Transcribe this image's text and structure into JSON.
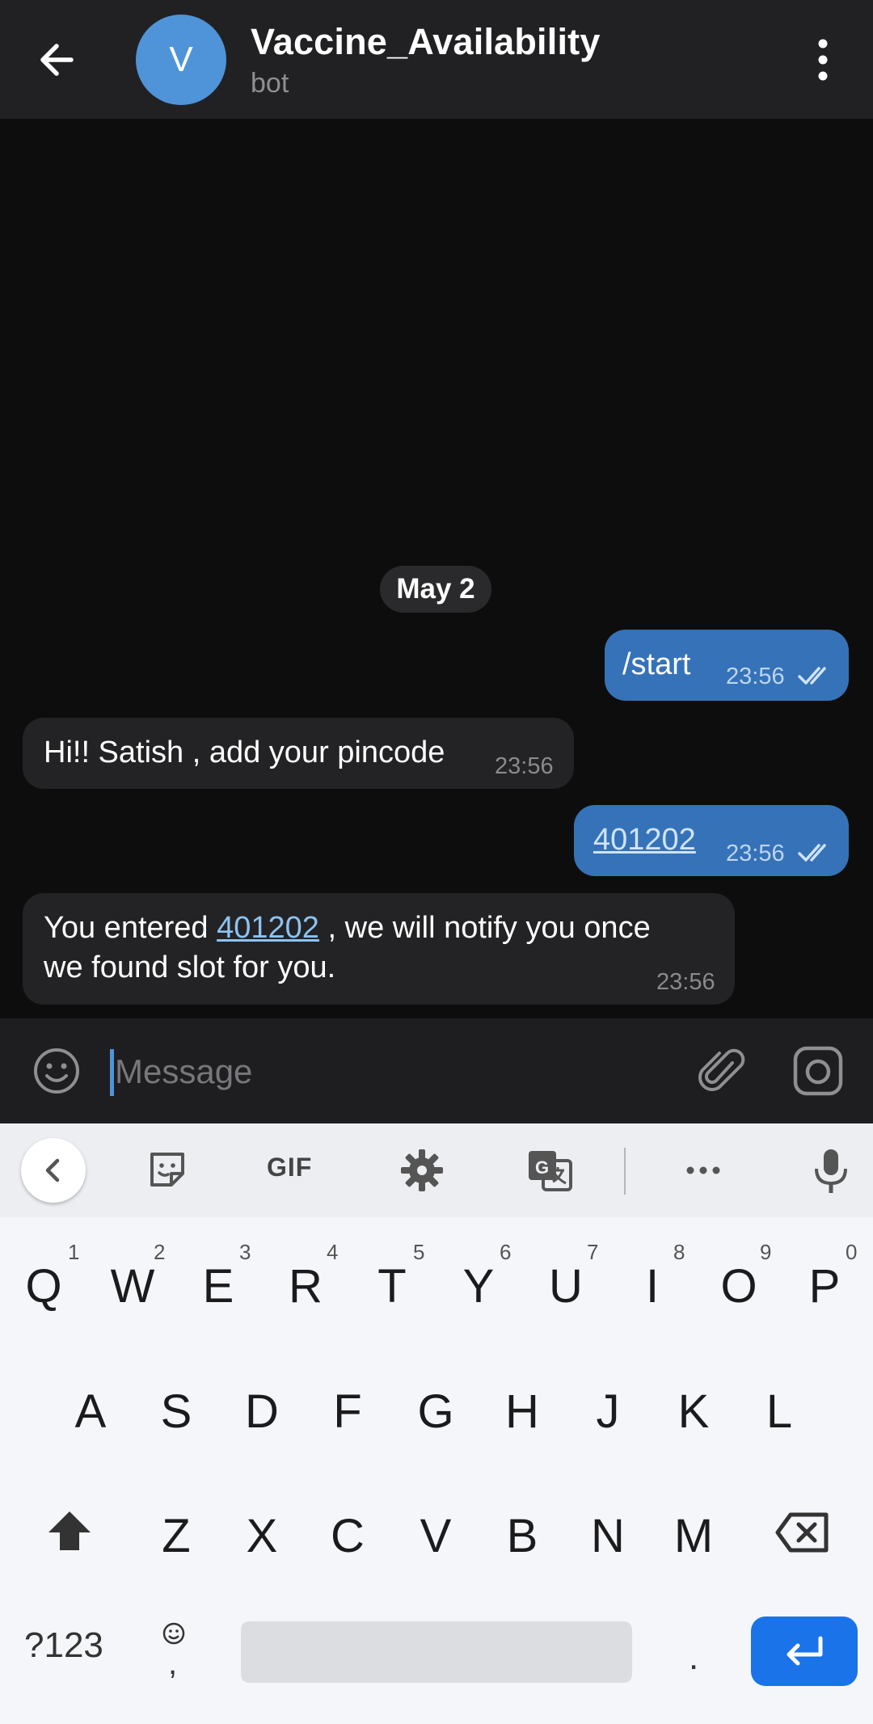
{
  "header": {
    "back_icon": "arrow-left-icon",
    "avatar_letter": "V",
    "title": "Vaccine_Availability",
    "subtitle": "bot",
    "menu_icon": "more-vertical-icon"
  },
  "chat": {
    "date_chip": "May 2",
    "messages": [
      {
        "direction": "out",
        "text": "/start",
        "time": "23:56",
        "status": "read"
      },
      {
        "direction": "in",
        "text": "Hi!! Satish , add your pincode",
        "time": "23:56"
      },
      {
        "direction": "out",
        "text": "401202",
        "time": "23:56",
        "status": "read"
      },
      {
        "direction": "in",
        "text_before": "You entered",
        "link": "401202",
        "text_after": ", we will notify you once",
        "text_line2": "we found slot for you.",
        "time": "23:56"
      }
    ]
  },
  "input": {
    "placeholder": "Message",
    "value": "",
    "emoji_icon": "smiley-icon",
    "attach_icon": "paperclip-icon",
    "camera_icon": "camera-icon"
  },
  "keyboard": {
    "toolbar": {
      "back_icon": "chevron-left-icon",
      "sticker_icon": "sticker-icon",
      "gif_label": "GIF",
      "settings_icon": "gear-icon",
      "translate_icon": "translate-icon",
      "more_icon": "more-horizontal-icon",
      "mic_icon": "microphone-icon"
    },
    "row1": [
      {
        "key": "Q",
        "hint": "1"
      },
      {
        "key": "W",
        "hint": "2"
      },
      {
        "key": "E",
        "hint": "3"
      },
      {
        "key": "R",
        "hint": "4"
      },
      {
        "key": "T",
        "hint": "5"
      },
      {
        "key": "Y",
        "hint": "6"
      },
      {
        "key": "U",
        "hint": "7"
      },
      {
        "key": "I",
        "hint": "8"
      },
      {
        "key": "O",
        "hint": "9"
      },
      {
        "key": "P",
        "hint": "0"
      }
    ],
    "row2": [
      "A",
      "S",
      "D",
      "F",
      "G",
      "H",
      "J",
      "K",
      "L"
    ],
    "row3": [
      "Z",
      "X",
      "C",
      "V",
      "B",
      "N",
      "M"
    ],
    "shift_icon": "shift-icon",
    "backspace_icon": "backspace-icon",
    "symbols_label": "?123",
    "emoji_key_icon": "smiley-icon",
    "comma_label": ",",
    "period_label": ".",
    "enter_icon": "enter-icon",
    "accent_color": "#1a73e8"
  }
}
